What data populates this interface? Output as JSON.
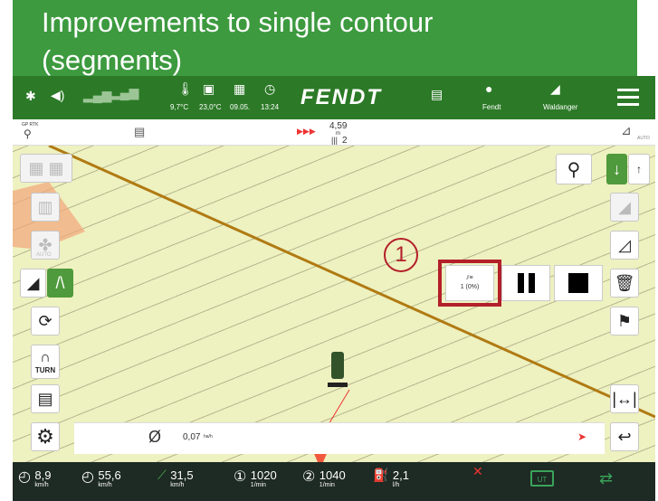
{
  "slide": {
    "title_line1": "Improvements to single contour",
    "title_line2": "(segments)"
  },
  "status_bar": {
    "temp1": "9,7°C",
    "temp2": "23,0°C",
    "date": "09.05.",
    "time": "13:24",
    "brand": "FENDT",
    "user1": "Fendt",
    "user2": "Waldanger"
  },
  "info_bar": {
    "gps_label": "GP RTK",
    "distance": "4,59",
    "distance_unit": "m",
    "track_number": "2",
    "auto_label": "AUTO"
  },
  "map": {
    "segment_label": "1 (0%)",
    "callout_number": "1",
    "marker_label": "1",
    "auto_label": "AUTO",
    "turn_label": "TURN",
    "rate_value": "0,07",
    "rate_unit": "ha/h"
  },
  "bottom_bar": {
    "speed1": "8,9",
    "speed1_unit": "km/h",
    "speed2": "55,6",
    "speed2_unit": "km/h",
    "speed3": "31,5",
    "speed3_unit": "km/h",
    "rpm1": "1020",
    "rpm1_unit": "1/min",
    "rpm2": "1040",
    "rpm2_unit": "1/min",
    "fuel": "2,1",
    "fuel_unit": "l/h",
    "ut_label": "UT"
  },
  "colors": {
    "title_green": "#3d9a3f",
    "status_green": "#2c7a27",
    "map_bg": "#eef1c0",
    "highlight_red": "#b3202a",
    "track_brown": "#b07a12"
  }
}
